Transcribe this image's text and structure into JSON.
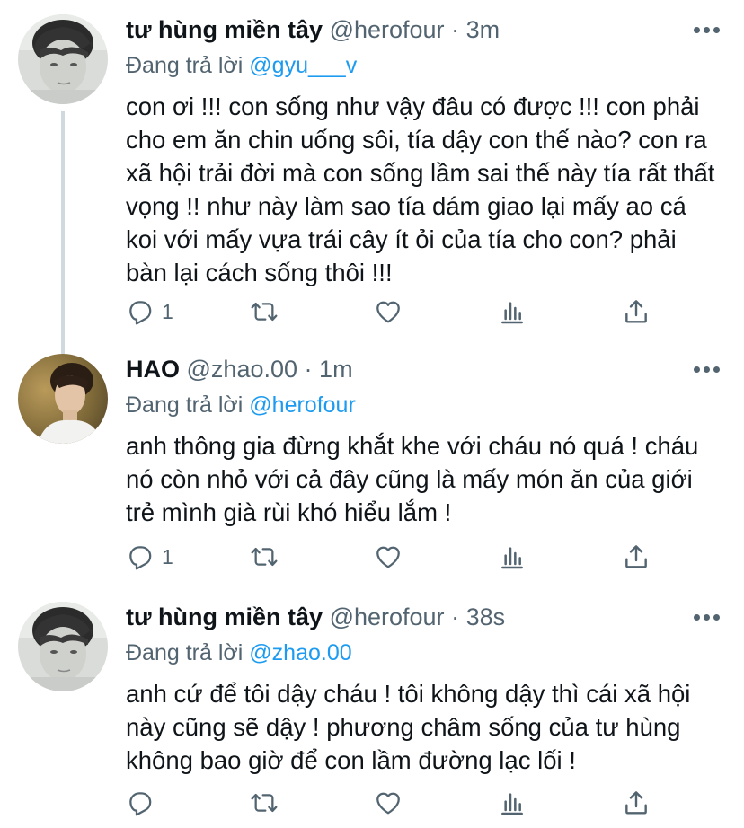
{
  "tweets": [
    {
      "name": "tư hùng miền tây",
      "handle": "@herofour",
      "sep": "·",
      "time": "3m",
      "replying_prefix": "Đang trả lời",
      "replying_to": "@gyu___v",
      "text": "con ơi !!! con sống như vậy đâu có được !!! con phải cho em ăn chin uống sôi, tía dậy con thế nào? con ra xã hội trải đời mà con sống lầm sai thế này tía rất thất vọng !! như này làm sao tía dám giao lại mấy ao cá koi với mấy vựa trái cây ít ỏi của tía cho con? phải bàn lại cách sống thôi !!!",
      "reply_count": "1",
      "avatar": "boy-selfie-grayscale"
    },
    {
      "name": "HAO",
      "handle": "@zhao.00",
      "sep": "·",
      "time": "1m",
      "replying_prefix": "Đang trả lời",
      "replying_to": "@herofour",
      "text": "anh thông gia đừng khắt khe với cháu nó quá ! cháu nó còn nhỏ với cả đây cũng là mấy món ăn của giới trẻ mình già rùi khó hiểu lắm !",
      "reply_count": "1",
      "avatar": "young-man-profile-golden"
    },
    {
      "name": "tư hùng miền tây",
      "handle": "@herofour",
      "sep": "·",
      "time": "38s",
      "replying_prefix": "Đang trả lời",
      "replying_to": "@zhao.00",
      "text": "anh cứ để tôi dậy cháu ! tôi không dậy thì cái xã hội này cũng sẽ dậy ! phương châm sống của tư hùng không bao giờ để con lầm đường lạc lối !",
      "reply_count": "",
      "avatar": "boy-selfie-grayscale"
    }
  ],
  "icons": {
    "reply": "reply-icon",
    "retweet": "retweet-icon",
    "like": "heart-icon",
    "analytics": "analytics-icon",
    "share": "share-icon",
    "more": "more-icon"
  },
  "colors": {
    "link": "#1d9bf0",
    "secondary": "#536471",
    "text": "#0f1419",
    "thread_line": "#cfd9de"
  }
}
